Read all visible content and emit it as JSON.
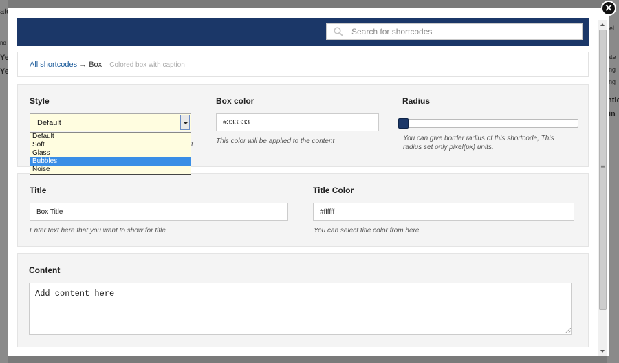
{
  "background_fragments": [
    "ate",
    "nd",
    "Ye",
    "Ye",
    "rel",
    "ate",
    "ing",
    "ing",
    "ntio",
    "in"
  ],
  "close_label": "×",
  "search": {
    "placeholder": "Search for shortcodes",
    "value": ""
  },
  "breadcrumb": {
    "root": "All shortcodes",
    "arrow": "→",
    "current": "Box",
    "description": "Colored box with caption"
  },
  "style": {
    "label": "Style",
    "selected": "Default",
    "options": [
      "Default",
      "Soft",
      "Glass",
      "Bubbles",
      "Noise"
    ],
    "highlighted_index": 3,
    "help_fragment": "t"
  },
  "box_color": {
    "label": "Box color",
    "value": "#333333",
    "help": "This color will be applied to the content"
  },
  "radius": {
    "label": "Radius",
    "value_fraction": 0,
    "help": "You can give border radius of this shortcode, This radius set only pixel(px) units."
  },
  "title": {
    "label": "Title",
    "value": "Box Title",
    "help": "Enter text here that you want to show for title"
  },
  "title_color": {
    "label": "Title Color",
    "value": "#ffffff",
    "help": "You can select title color from here."
  },
  "content": {
    "label": "Content",
    "value": "Add content here"
  },
  "colors": {
    "header": "#1b3768",
    "accent": "#1a5a9a",
    "select_bg": "#fffde0",
    "highlight": "#3a8ee6"
  },
  "icons": {
    "search": "search-icon",
    "close": "close-icon",
    "dropdown": "chevron-down-icon",
    "slider": "slider-handle"
  }
}
